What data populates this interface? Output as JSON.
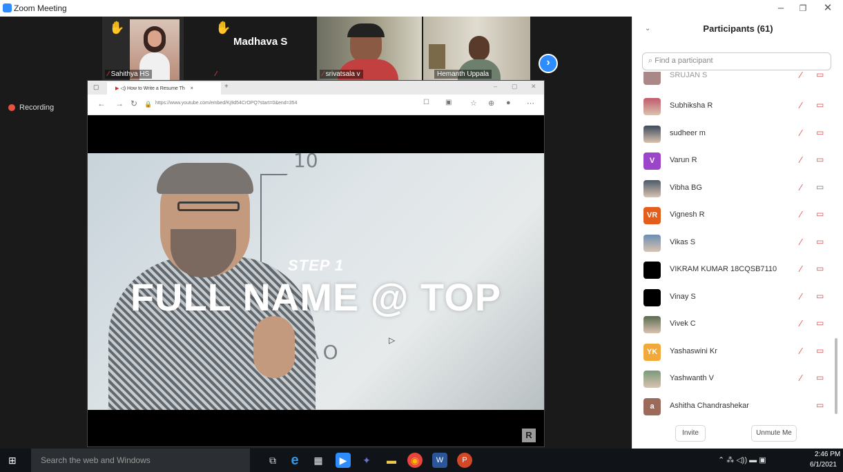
{
  "window": {
    "title": "Zoom Meeting"
  },
  "video_strip": {
    "thumbnails": [
      {
        "name": "Sahithya HS",
        "hand_raised": true
      },
      {
        "name": "Madhava S",
        "hand_raised": true
      },
      {
        "name": "srivatsala v",
        "hand_raised": false
      },
      {
        "name": "Hemanth Uppala",
        "hand_raised": false
      }
    ],
    "next_icon": "chevron-right-icon"
  },
  "recording": {
    "label": "Recording",
    "color": "#e8513c"
  },
  "shared_screen": {
    "tab_title": "How to Write a Resume Th",
    "url": "https://www.youtube.com/embed/Kj9d54CrOPQ?start=0&end=354",
    "video": {
      "step_text": "STEP 1",
      "headline": "FULL NAME @ TOP",
      "board_text_top": "10",
      "board_text_bottom": "AO",
      "watermark": "R"
    }
  },
  "participants": {
    "title": "Participants (61)",
    "search_placeholder": "Find a participant",
    "truncated_top": "SRUJAN S",
    "items": [
      {
        "name": "Subhiksha R",
        "avatar": "photo",
        "color": "#c15a6b",
        "muted": true,
        "video_off": true
      },
      {
        "name": "sudheer m",
        "avatar": "photo",
        "color": "#3d4a5c",
        "muted": true,
        "video_off": true
      },
      {
        "name": "Varun R",
        "avatar": "V",
        "color": "#9b45c9",
        "muted": true,
        "video_off": true
      },
      {
        "name": "Vibha BG",
        "avatar": "photo",
        "color": "#4a5a6c",
        "muted": true,
        "video_off": false
      },
      {
        "name": "Vignesh R",
        "avatar": "VR",
        "color": "#e35d1c",
        "muted": true,
        "video_off": true
      },
      {
        "name": "Vikas S",
        "avatar": "photo",
        "color": "#6b8fb2",
        "muted": true,
        "video_off": true
      },
      {
        "name": "VIKRAM KUMAR 18CQSB7110",
        "avatar": "",
        "color": "#000000",
        "muted": true,
        "video_off": true
      },
      {
        "name": "Vinay S",
        "avatar": "",
        "color": "#000000",
        "muted": true,
        "video_off": true
      },
      {
        "name": "Vivek C",
        "avatar": "photo",
        "color": "#5a6b52",
        "muted": true,
        "video_off": true
      },
      {
        "name": "Yashaswini Kr",
        "avatar": "YK",
        "color": "#f2a93b",
        "muted": true,
        "video_off": true
      },
      {
        "name": "Yashwanth V",
        "avatar": "photo",
        "color": "#7a9a7a",
        "muted": true,
        "video_off": true
      },
      {
        "name": "Ashitha Chandrashekar",
        "avatar": "a",
        "color": "#9b6a5a",
        "muted": false,
        "video_off": true
      }
    ],
    "invite_label": "Invite",
    "unmute_label": "Unmute Me"
  },
  "taskbar": {
    "search_placeholder": "Search the web and Windows",
    "time": "2:46 PM",
    "date": "6/1/2021"
  }
}
